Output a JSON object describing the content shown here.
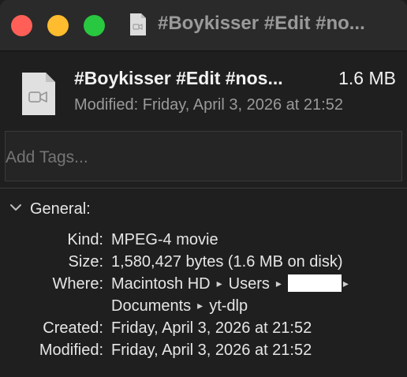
{
  "window": {
    "title": "#Boykisser #Edit #no..."
  },
  "header": {
    "file_name": "#Boykisser #Edit #nos...",
    "file_size": "1.6 MB",
    "modified": "Modified: Friday, April 3, 2026 at 21:52",
    "icon": "movie-file-icon"
  },
  "tags": {
    "placeholder": "Add Tags..."
  },
  "general": {
    "title": "General:",
    "kind_label": "Kind:",
    "kind_value": "MPEG-4 movie",
    "size_label": "Size:",
    "size_value": "1,580,427 bytes (1.6 MB on disk)",
    "where_label": "Where:",
    "where_path": [
      "Macintosh HD",
      "Users",
      "Documents",
      "yt-dlp"
    ],
    "created_label": "Created:",
    "created_value": "Friday, April 3, 2026 at 21:52",
    "modified_label": "Modified:",
    "modified_value": "Friday, April 3, 2026 at 21:52"
  },
  "colors": {
    "close": "#ff5f57",
    "minimize": "#febc2e",
    "zoom": "#28c840",
    "background": "#1f1f1f"
  }
}
